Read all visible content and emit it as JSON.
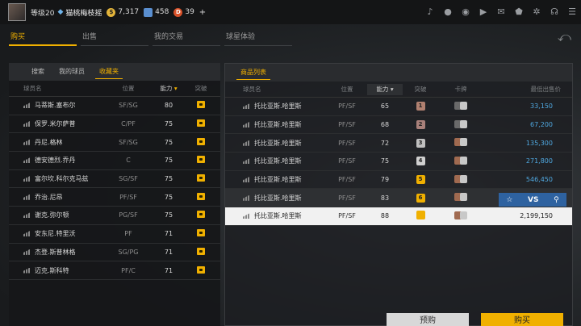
{
  "header": {
    "level": "等级20",
    "username": "猫桃梅枝摇",
    "coins": "7,317",
    "tickets": "458",
    "points": "39",
    "plus": "+"
  },
  "nav": {
    "tabs": [
      {
        "label": "购买"
      },
      {
        "label": "出售"
      },
      {
        "label": "我的交易"
      },
      {
        "label": "球星体验"
      }
    ]
  },
  "left": {
    "tabs": [
      {
        "label": "搜索"
      },
      {
        "label": "我的球员"
      },
      {
        "label": "收藏夹"
      }
    ],
    "columns": {
      "name": "球员名",
      "position": "位置",
      "rating": "能力",
      "break": "突破"
    },
    "rows": [
      {
        "name": "马蒂斯.塞布尔",
        "position": "SF/SG",
        "rating": "80"
      },
      {
        "name": "保罗.米尔萨普",
        "position": "C/PF",
        "rating": "75"
      },
      {
        "name": "丹尼.格林",
        "position": "SF/SG",
        "rating": "75"
      },
      {
        "name": "德安德烈.乔丹",
        "position": "C",
        "rating": "75"
      },
      {
        "name": "富尔坎.科尔克马兹",
        "position": "SG/SF",
        "rating": "75"
      },
      {
        "name": "乔治.尼昂",
        "position": "PF/SF",
        "rating": "75"
      },
      {
        "name": "谢克.弥尔顿",
        "position": "PG/SF",
        "rating": "75"
      },
      {
        "name": "安东尼.特里沃",
        "position": "PF",
        "rating": "71"
      },
      {
        "name": "杰登.斯普林格",
        "position": "SG/PG",
        "rating": "71"
      },
      {
        "name": "迈克.斯科特",
        "position": "PF/C",
        "rating": "71"
      }
    ]
  },
  "right": {
    "tab": "商品列表",
    "columns": {
      "name": "球员名",
      "position": "位置",
      "rating": "能力",
      "break": "突破",
      "cards": "卡牌",
      "price": "最低出售价"
    },
    "rows": [
      {
        "name": "托比亚斯.哈里斯",
        "position": "PF/SF",
        "rating": "65",
        "break": "1",
        "price": "33,150"
      },
      {
        "name": "托比亚斯.哈里斯",
        "position": "PF/SF",
        "rating": "68",
        "break": "2",
        "price": "67,200"
      },
      {
        "name": "托比亚斯.哈里斯",
        "position": "PF/SF",
        "rating": "72",
        "break": "3",
        "price": "135,300"
      },
      {
        "name": "托比亚斯.哈里斯",
        "position": "PF/SF",
        "rating": "75",
        "break": "4",
        "price": "271,800"
      },
      {
        "name": "托比亚斯.哈里斯",
        "position": "PF/SF",
        "rating": "79",
        "break": "5",
        "price": "546,450"
      },
      {
        "name": "托比亚斯.哈里斯",
        "position": "PF/SF",
        "rating": "83",
        "break": "6",
        "price": ""
      },
      {
        "name": "托比亚斯.哈里斯",
        "position": "PF/SF",
        "rating": "88",
        "break": "",
        "price": "2,199,150"
      }
    ],
    "actions": {
      "vs": "VS"
    }
  },
  "buttons": {
    "preorder": "预购",
    "buy": "购买"
  },
  "colors": {
    "accent": "#f0b000",
    "price": "#4fa8e0",
    "action": "#2e62a0"
  }
}
